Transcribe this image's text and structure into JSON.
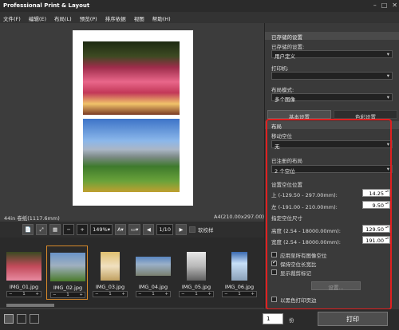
{
  "app": {
    "title": "Professional Print & Layout"
  },
  "menu": [
    "文件(F)",
    "编辑(E)",
    "布局(L)",
    "预览(P)",
    "排序依据",
    "视图",
    "帮助(H)"
  ],
  "status": {
    "left": "44in 卷纸(1117.6mm)",
    "right": "A4(210.00x297.00)"
  },
  "toolbar": {
    "zoom": "149%",
    "page": "1/10",
    "proof_label": "软校样"
  },
  "thumbnails": [
    {
      "name": "IMG_01.jpg",
      "count": "1",
      "color": "#c24a5a"
    },
    {
      "name": "IMG_02.jpg",
      "count": "1",
      "color": "#6a94c8"
    },
    {
      "name": "IMG_03.jpg",
      "count": "1",
      "color": "#e0c070"
    },
    {
      "name": "IMG_04.jpg",
      "count": "1",
      "color": "#5a86c0"
    },
    {
      "name": "IMG_05.jpg",
      "count": "1",
      "color": "#c8c8c8"
    },
    {
      "name": "IMG_06.jpg",
      "count": "1",
      "color": "#3a6ab0"
    }
  ],
  "panel": {
    "saved_settings_header": "已存储的设置",
    "saved_settings_label": "已存储的设置:",
    "saved_settings_value": "用户定义",
    "printer_label": "打印机:",
    "printer_value": "",
    "layout_mode_label": "布局模式:",
    "layout_mode_value": "多个图像",
    "tab_basic": "基本设置",
    "tab_color": "色彩设置",
    "layout_header": "布局",
    "move_space_label": "移动空位",
    "move_space_value": "无",
    "registered_layout_label": "已注册的布局",
    "registered_layout_value": "2 个空位",
    "space_pos_label": "设置空位位置",
    "top_label": "上 (-129.50 - 297.00mm):",
    "top_value": "14.25",
    "left_label": "左 (-191.00 - 210.00mm):",
    "left_value": "9.50",
    "space_size_label": "指定空位尺寸",
    "height_label": "高度 (2.54 - 18000.00mm):",
    "height_value": "129.50",
    "width_label": "宽度 (2.54 - 18000.00mm):",
    "width_value": "191.00",
    "apply_all_label": "应用至所有图像空位",
    "keep_ratio_label": "保持空位长宽比",
    "show_crop_label": "显示裁剪标记",
    "settings_button": "设置...",
    "borderless_label": "以黑色打印页边"
  },
  "bottom": {
    "copies_value": "1",
    "copies_unit": "份",
    "print_button": "打印"
  },
  "colors": {
    "highlight": "#e02020",
    "selection": "#d88a2a"
  }
}
